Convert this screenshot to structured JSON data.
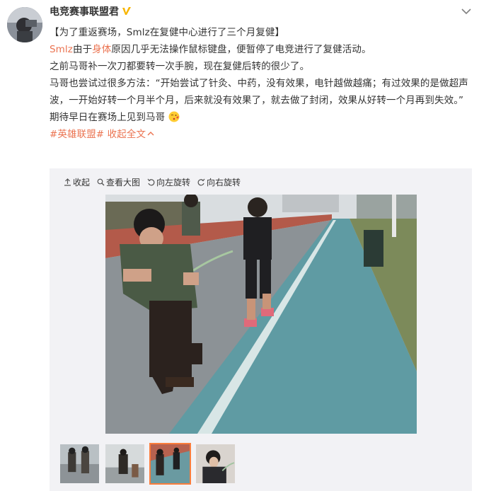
{
  "post": {
    "username": "电竞赛事联盟君",
    "paragraphs": {
      "title": "【为了重返赛场，Smlz在复健中心进行了三个月复健】",
      "p1_name": "Smlz",
      "p1_text1": "由于",
      "p1_link": "身体",
      "p1_text2": "原因几乎无法操作鼠标键盘，便暂停了电竞进行了复健活动。",
      "p2": "之前马哥补一次刀都要转一次手腕，现在复健后转的很少了。",
      "p3": "马哥也尝试过很多方法：“开始尝试了针灸、中药，没有效果，电针越做越痛；有过效果的是做超声波，一开始好转一个月半个月，后来就没有效果了，就去做了封闭，效果从好转一个月再到失效。”",
      "p4": "期待早日在赛场上见到马哥",
      "hashtag": "#英雄联盟#",
      "collapse_text": "收起全文"
    }
  },
  "media_toolbar": {
    "collapse": "收起",
    "view_large": "查看大图",
    "rotate_left": "向左旋转",
    "rotate_right": "向右旋转"
  },
  "thumbnails": {
    "count": 4,
    "active_index": 2
  },
  "colors": {
    "accent": "#eb7350",
    "verified": "#f7b500",
    "active_thumb_border": "#fa7d3c",
    "media_bg": "#f2f2f5"
  },
  "icons": [
    "verified-icon",
    "chevron-down-icon",
    "upload-icon",
    "search-icon",
    "rotate-left-icon",
    "rotate-right-icon",
    "kiss-emoji-icon",
    "chevron-up-icon"
  ]
}
